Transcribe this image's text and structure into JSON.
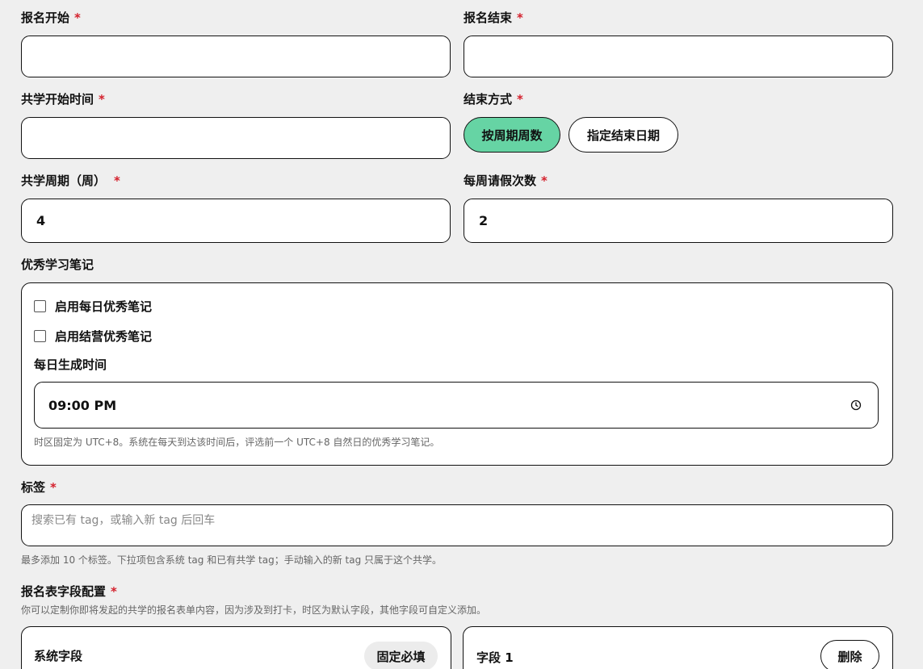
{
  "signup_start": {
    "label": "报名开始",
    "required_mark": "*",
    "value": ""
  },
  "signup_end": {
    "label": "报名结束",
    "required_mark": "*",
    "value": ""
  },
  "study_start": {
    "label": "共学开始时间",
    "required_mark": "*",
    "value": ""
  },
  "end_mode": {
    "label": "结束方式",
    "required_mark": "*",
    "options": [
      "按周期周数",
      "指定结束日期"
    ],
    "selected": "按周期周数"
  },
  "study_weeks": {
    "label": "共学周期（周）",
    "required_mark": "*",
    "value": "4"
  },
  "weekly_leave": {
    "label": "每周请假次数",
    "required_mark": "*",
    "value": "2"
  },
  "notes": {
    "label": "优秀学习笔记",
    "daily_checkbox": {
      "label": "启用每日优秀笔记",
      "checked": false
    },
    "camp_checkbox": {
      "label": "启用结营优秀笔记",
      "checked": false
    },
    "time_label": "每日生成时间",
    "time_value": "09:00 PM",
    "time_icon": "clock-icon",
    "help": "时区固定为 UTC+8。系统在每天到达该时间后，评选前一个 UTC+8 自然日的优秀学习笔记。"
  },
  "tags": {
    "label": "标签",
    "required_mark": "*",
    "placeholder": "搜索已有 tag，或输入新 tag 后回车",
    "help": "最多添加 10 个标签。下拉项包含系统 tag 和已有共学 tag；手动输入的新 tag 只属于这个共学。"
  },
  "form_config": {
    "label": "报名表字段配置",
    "required_mark": "*",
    "help": "你可以定制你即将发起的共学的报名表单内容，因为涉及到打卡，时区为默认字段，其他字段可自定义添加。",
    "system_field": {
      "title": "系统字段",
      "badge": "固定必填"
    },
    "field_1": {
      "title": "字段 1",
      "delete_label": "删除"
    }
  },
  "colors": {
    "accent": "#66d4a4",
    "required": "#d4202c",
    "background": "#efefef"
  }
}
